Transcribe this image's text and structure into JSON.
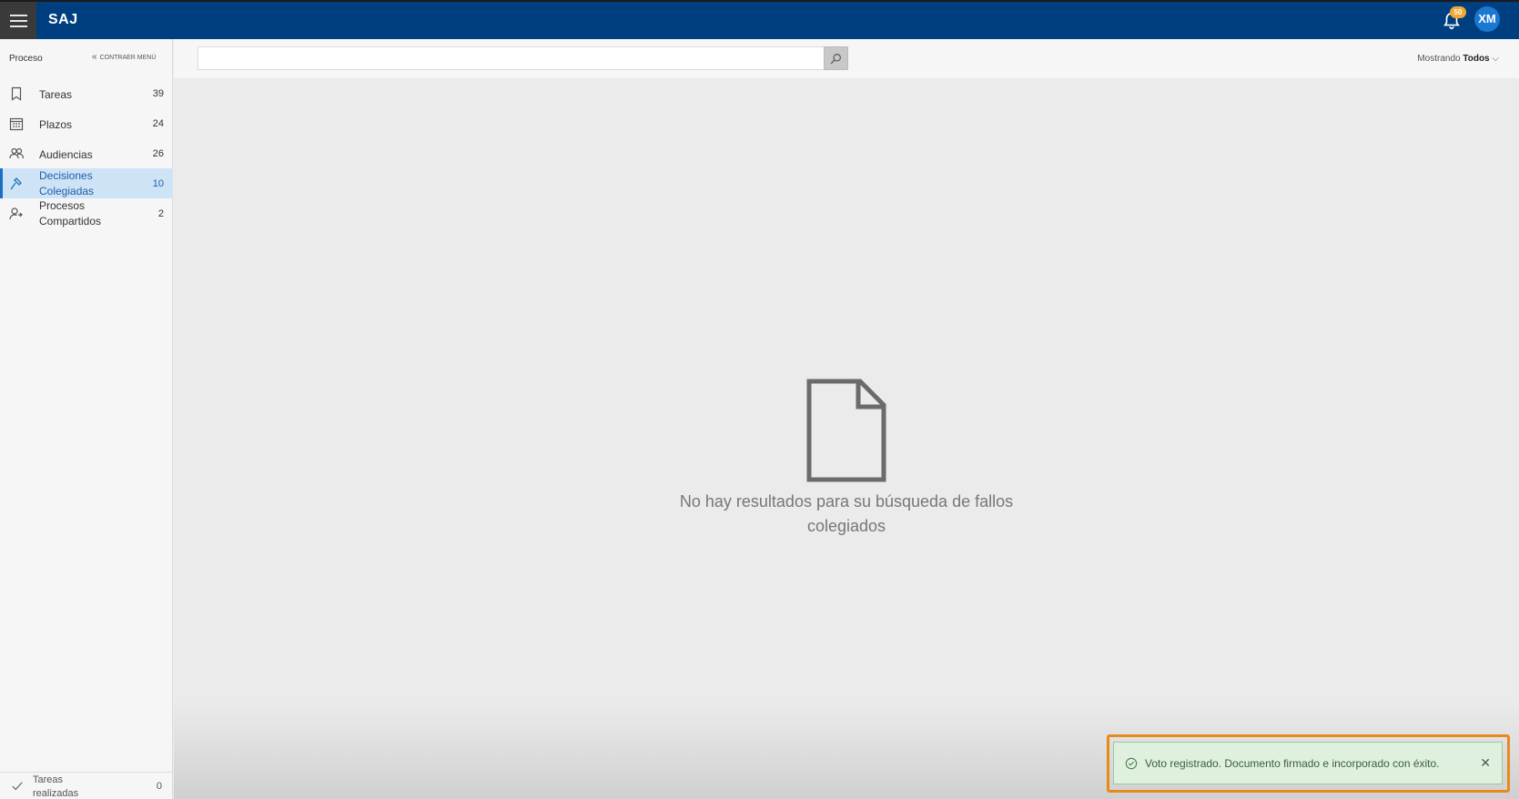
{
  "header": {
    "brand": "SAJ",
    "notifications_count": "50",
    "user_initials": "XM"
  },
  "sidebar": {
    "title": "Proceso",
    "collapse_label": "CONTRAER MENÚ",
    "items": [
      {
        "label": "Tareas",
        "count": "39",
        "icon": "bookmark-icon"
      },
      {
        "label": "Plazos",
        "count": "24",
        "icon": "calendar-icon"
      },
      {
        "label": "Audiencias",
        "count": "26",
        "icon": "people-icon"
      },
      {
        "label": "Decisiones\nColegiadas",
        "count": "10",
        "icon": "gavel-icon",
        "active": true
      },
      {
        "label": "Procesos\nCompartidos",
        "count": "2",
        "icon": "shared-person-icon"
      }
    ],
    "footer": {
      "label": "Tareas\nrealizadas",
      "count": "0"
    }
  },
  "search": {
    "placeholder": "",
    "showing_label": "Mostrando",
    "showing_value": "Todos"
  },
  "main": {
    "empty_message": "No hay resultados para su búsqueda de fallos colegiados"
  },
  "toast": {
    "message": "Voto registrado. Documento firmado e incorporado con éxito.",
    "close": "✕"
  },
  "colors": {
    "topbar": "#003f7f",
    "active_nav": "#cfe3f6",
    "accent": "#1b6fc2",
    "toast_bg": "#dff0df",
    "highlight": "#e8891c"
  }
}
